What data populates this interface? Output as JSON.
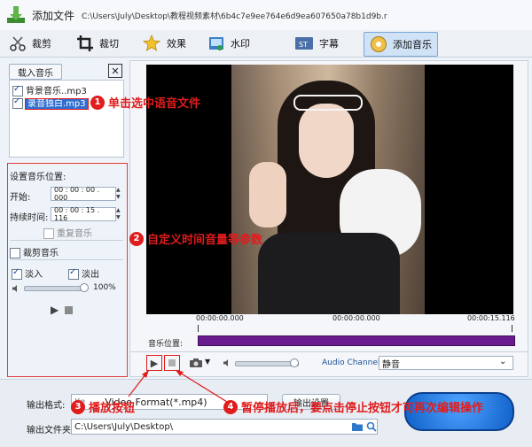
{
  "header": {
    "add_file_label": "添加文件",
    "file_path": "C:\\Users\\July\\Desktop\\教程视频素材\\6b4c7e9ee764e6d9ea607650a78b1d9b.r"
  },
  "toolbar": {
    "items": [
      {
        "label": "裁剪",
        "icon": "scissors-icon"
      },
      {
        "label": "裁切",
        "icon": "crop-icon"
      },
      {
        "label": "效果",
        "icon": "star-effect-icon"
      },
      {
        "label": "水印",
        "icon": "watermark-icon"
      },
      {
        "label": "字幕",
        "icon": "subtitle-icon"
      },
      {
        "label": "添加音乐",
        "icon": "music-icon"
      }
    ]
  },
  "left_panel": {
    "load_music_button": "载入音乐",
    "music_list": [
      {
        "name": "背景音乐..mp3",
        "checked": true
      },
      {
        "name": "录音独白.mp3",
        "checked": true
      }
    ],
    "set_music_position": "设置音乐位置:",
    "start_label": "开始:",
    "start_value": "00 : 00 : 00 . 000",
    "duration_label": "持续时间:",
    "duration_value": "00 : 00 : 15 . 116",
    "repeat_music": "重复音乐",
    "trim_music": "裁剪音乐",
    "fade_in": "淡入",
    "fade_out": "淡出",
    "volume_percent": "100%",
    "volume_level": 0.9
  },
  "preview": {
    "time_start": "00:00:00.000",
    "time_mid": "00:00:00.000",
    "time_end": "00:00:15.116",
    "music_position_label": "音乐位置:",
    "audio_channel_label": "Audio Channel:",
    "audio_channel_value": "静音"
  },
  "bottom": {
    "output_format_label": "输出格式:",
    "output_format_value": "Video Format(*.mp4)",
    "output_format_prefix": "Ke",
    "output_settings_button": "输出设置",
    "output_folder_label": "输出文件夹:",
    "output_folder_value": "C:\\Users\\July\\Desktop\\"
  },
  "annotations": {
    "a1_num": "1",
    "a1_text": "单击选中语音文件",
    "a2_num": "2",
    "a2_text": "自定义时间音量等参数",
    "a3_num": "3",
    "a3_text": "播放按钮",
    "a4_num": "4",
    "a4_text": "暂停播放后，要点击停止按钮才可再次编辑操作"
  },
  "colors": {
    "annotation_red": "#e01c1c",
    "timeline_purple": "#6a1b8f",
    "accent_blue": "#1e6fd1"
  }
}
